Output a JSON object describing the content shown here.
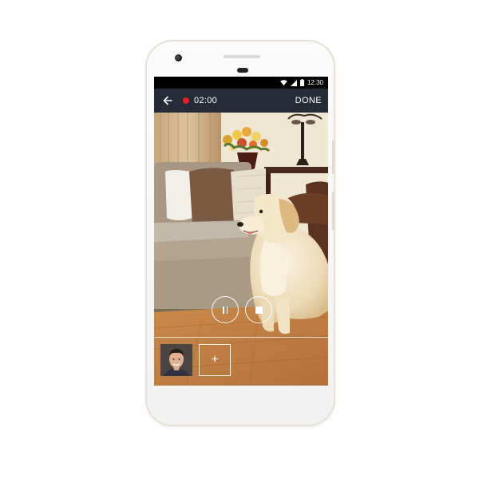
{
  "status_bar": {
    "time": "12:30",
    "icons": [
      "wifi-icon",
      "signal-icon",
      "battery-icon"
    ]
  },
  "app_bar": {
    "back_icon": "arrow-left-icon",
    "recording_indicator_color": "#e8202a",
    "timer": "02:00",
    "done_label": "DONE",
    "background": "#252c37"
  },
  "controls": {
    "pause_icon": "pause-icon",
    "stop_icon": "stop-icon"
  },
  "thumbnails": {
    "avatar": "person-avatar",
    "add_label": "+"
  }
}
